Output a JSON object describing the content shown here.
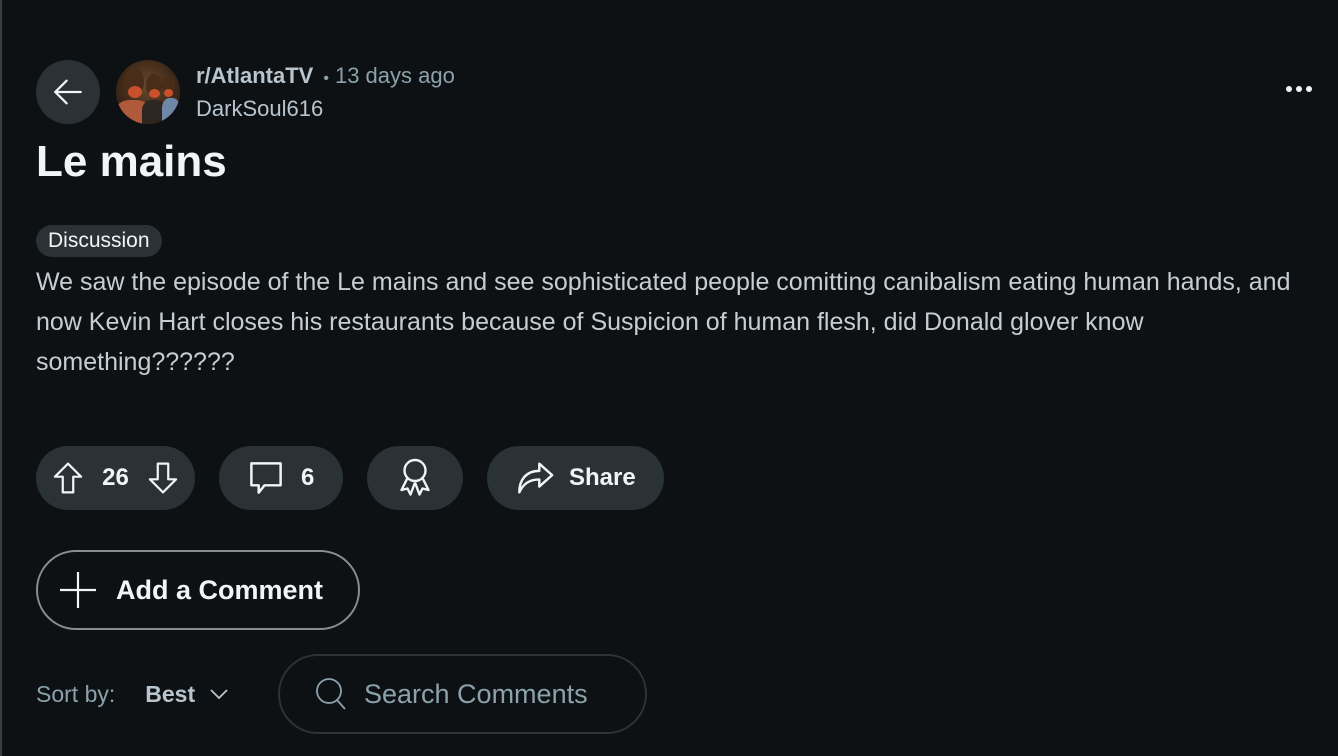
{
  "post": {
    "subreddit": "r/AtlantaTV",
    "separator": "•",
    "time_ago": "13 days ago",
    "author": "DarkSoul616",
    "title": "Le mains",
    "flair": "Discussion",
    "body": "We saw the episode of the Le mains and see sophisticated people comitting canibalism eating human hands, and now Kevin Hart closes his restaurants because of Suspicion of human flesh, did Donald glover know something??????"
  },
  "actions": {
    "vote_count": "26",
    "comment_count": "6",
    "share_label": "Share"
  },
  "comments": {
    "add_label": "Add a Comment",
    "sort_label": "Sort by:",
    "sort_value": "Best",
    "search_placeholder": "Search Comments"
  },
  "icons": {
    "back": "arrow-left-icon",
    "more": "more-horizontal-icon",
    "upvote": "arrow-up-icon",
    "downvote": "arrow-down-icon",
    "comment": "speech-bubble-icon",
    "award": "award-ribbon-icon",
    "share": "share-arrow-icon",
    "add": "plus-icon",
    "sort": "chevron-down-icon",
    "search": "search-icon"
  },
  "colors": {
    "background": "#0e1113",
    "pill": "#2a3236",
    "text_primary": "#f2f4f5",
    "text_secondary": "#8ba2ad"
  }
}
